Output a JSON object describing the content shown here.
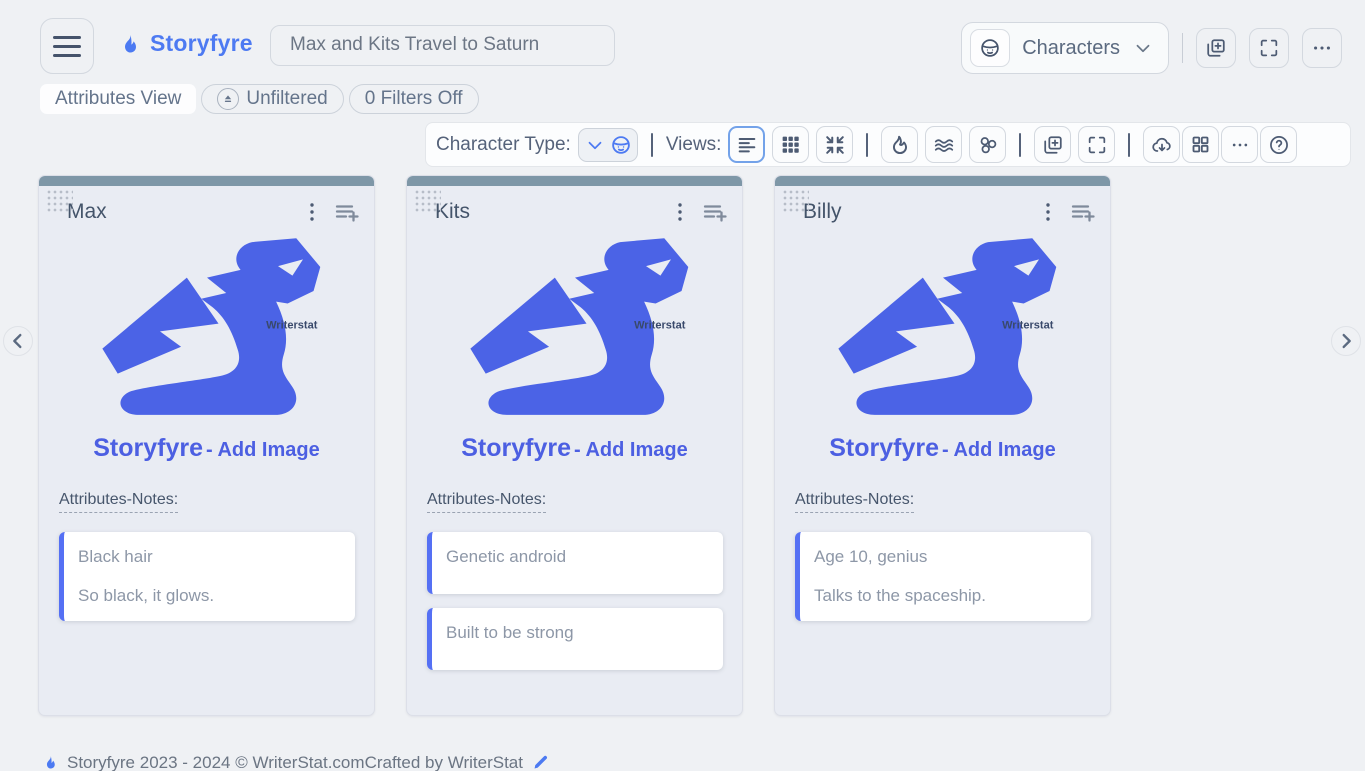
{
  "header": {
    "app_name": "Storyfyre",
    "story_title": "Max and Kits Travel to Saturn",
    "entity_dropdown_label": "Characters",
    "view_pill": "Attributes View",
    "filter_pill": "Unfiltered",
    "filters_count_pill": "0 Filters Off"
  },
  "toolbar": {
    "character_type_label": "Character Type:",
    "views_label": "Views:",
    "divider": "|"
  },
  "cards": [
    {
      "name": "Max",
      "watermark": "Writerstat",
      "caption_brand": "Storyfyre",
      "caption_action": "- Add Image",
      "notes_label": "Attributes-Notes:",
      "notes": [
        {
          "lines": [
            "Black hair",
            "So black, it glows."
          ]
        }
      ]
    },
    {
      "name": "Kits",
      "watermark": "Writerstat",
      "caption_brand": "Storyfyre",
      "caption_action": "- Add Image",
      "notes_label": "Attributes-Notes:",
      "notes": [
        {
          "lines": [
            "Genetic android"
          ]
        },
        {
          "lines": [
            "Built to be strong"
          ]
        }
      ]
    },
    {
      "name": "Billy",
      "watermark": "Writerstat",
      "caption_brand": "Storyfyre",
      "caption_action": "- Add Image",
      "notes_label": "Attributes-Notes:",
      "notes": [
        {
          "lines": [
            "Age 10, genius",
            "Talks to the spaceship."
          ]
        }
      ]
    }
  ],
  "footer": {
    "copyright": "Storyfyre 2023 - 2024 ©  WriterStat.com",
    "credit": "Crafted by WriterStat"
  },
  "icons": {
    "menu": "hamburger-lines",
    "flame": "blue-flame",
    "character_face": "boy-face-circle",
    "chevron_down": "v",
    "duplicate": "copy-plus",
    "fullscreen": "corner-brackets",
    "more": "horizontal-ellipsis",
    "filter": "eject-funnel",
    "view_list": "align-left-lines",
    "view_grid": "grid-3x3",
    "view_compact": "arrows-minimize",
    "waves": "triple-wave",
    "cluster": "three-circles",
    "cloud_download": "cloud-down-arrow",
    "grid_menu": "grid-2x2",
    "help": "question-circle",
    "kebab": "vertical-ellipsis",
    "add_note": "lines-plus",
    "nav_prev": "chevron-left-circle",
    "nav_next": "chevron-right-circle",
    "pencil": "edit-pencil"
  },
  "colors": {
    "page_bg": "#eff1f4",
    "accent_blue": "#4d7af2",
    "dragon_blue": "#4b63e6",
    "caption_blue": "#4c5fe2",
    "card_topbar": "#7e97a7",
    "card_bg": "#e9ecf3",
    "note_accent": "#5570f4",
    "slate_text": "#64748b"
  }
}
